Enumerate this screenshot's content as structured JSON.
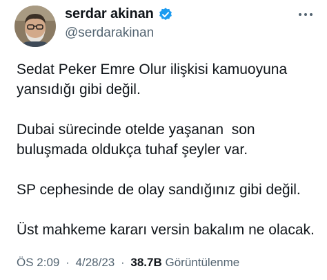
{
  "author": {
    "display_name": "serdar akinan",
    "handle": "@serdarakinan",
    "verified": true,
    "verified_color": "#1d9bf0",
    "avatar_icon": "profile-photo"
  },
  "more_icon": "more-horizontal-icon",
  "tweet": {
    "paragraphs": [
      "Sedat Peker Emre Olur ilişkisi kamuoyuna\nyansıdığı gibi değil.",
      "Dubai sürecinde otelde yaşanan  son\nbuluşmada oldukça tuhaf şeyler var.",
      "SP cephesinde de olay sandığınız gibi değil.",
      "Üst mahkeme kararı versin bakalım ne olacak."
    ]
  },
  "meta": {
    "time": "ÖS 2:09",
    "separator": "·",
    "date": "4/28/23",
    "views_count": "38.7B",
    "views_label": "Görüntülenme"
  },
  "colors": {
    "text_primary": "#0f1419",
    "text_secondary": "#536471"
  }
}
